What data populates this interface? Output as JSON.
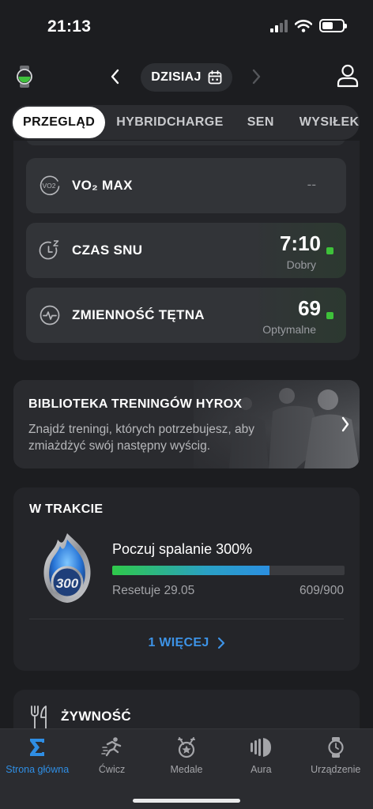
{
  "status_bar": {
    "time": "21:13"
  },
  "top_nav": {
    "date_label": "DZISIAJ"
  },
  "tabs": [
    {
      "label": "PRZEGLĄD",
      "active": true
    },
    {
      "label": "HYBRIDCHARGE",
      "active": false
    },
    {
      "label": "SEN",
      "active": false
    },
    {
      "label": "WYSIŁEK",
      "active": false
    }
  ],
  "metrics": [
    {
      "label": "VO₂ MAX",
      "value": "--",
      "sub": "",
      "icon": "vo2-icon"
    },
    {
      "label": "CZAS SNU",
      "value": "7:10",
      "sub": "Dobry",
      "icon": "sleep-timer-icon"
    },
    {
      "label": "ZMIENNOŚĆ TĘTNA",
      "value": "69",
      "sub": "Optymalne",
      "icon": "heart-rate-variability-icon"
    }
  ],
  "vo2_icon_text": "VO2",
  "hyrox": {
    "title": "BIBLIOTEKA TRENINGÓW HYROX",
    "description": "Znajdź treningi, których potrzebujesz, aby zmiażdżyć swój następny wyścig."
  },
  "in_progress": {
    "title": "W TRAKCIE",
    "badge_number": "300",
    "challenge": "Poczuj spalanie 300%",
    "progress": 0.677,
    "reset": "Resetuje 29.05",
    "count": "609/900",
    "more_link": "1 WIĘCEJ"
  },
  "food": {
    "label": "ŻYWNOŚĆ"
  },
  "bottom_nav": [
    {
      "label": "Strona główna",
      "icon": "sigma-home-icon",
      "active": true
    },
    {
      "label": "Ćwicz",
      "icon": "runner-icon",
      "active": false
    },
    {
      "label": "Medale",
      "icon": "medal-icon",
      "active": false
    },
    {
      "label": "Aura",
      "icon": "aura-icon",
      "active": false
    },
    {
      "label": "Urządzenie",
      "icon": "watch-device-icon",
      "active": false
    }
  ],
  "colors": {
    "accent": "#2f8ee4",
    "good_status": "#3ec13a",
    "background": "#1c1d20",
    "card": "#242529"
  }
}
